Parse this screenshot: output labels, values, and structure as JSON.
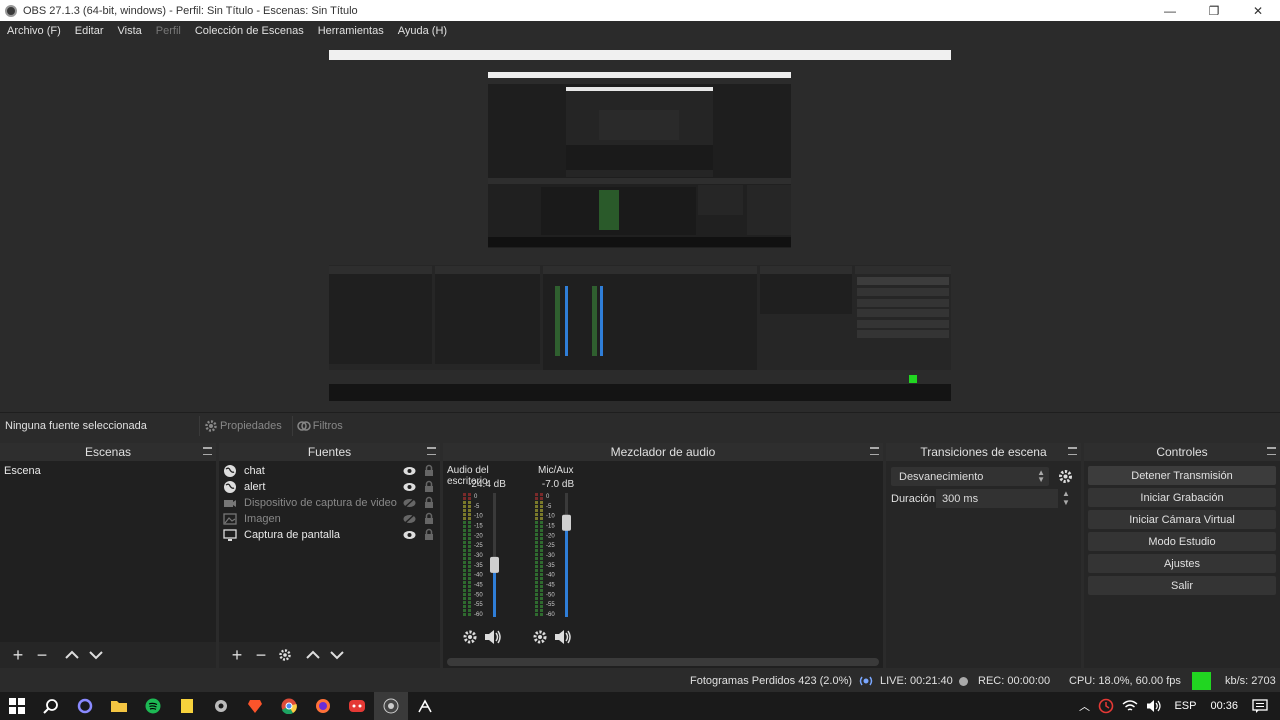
{
  "window": {
    "title": "OBS 27.1.3 (64-bit, windows) - Perfil: Sin Título - Escenas: Sin Título",
    "minimize": "—",
    "restore": "❐",
    "close": "✕"
  },
  "menu": {
    "items": [
      "Archivo (F)",
      "Editar",
      "Vista",
      "Perfil",
      "Colección de Escenas",
      "Herramientas",
      "Ayuda (H)"
    ]
  },
  "context_bar": {
    "no_source": "Ninguna fuente seleccionada",
    "properties": "Propiedades",
    "filters": "Filtros"
  },
  "scenes": {
    "header": "Escenas",
    "items": [
      "Escena"
    ]
  },
  "sources": {
    "header": "Fuentes",
    "items": [
      {
        "name": "chat",
        "icon": "globe-icon",
        "visible": true
      },
      {
        "name": "alert",
        "icon": "globe-icon",
        "visible": true
      },
      {
        "name": "Dispositivo de captura de video",
        "icon": "camera-icon",
        "visible": false
      },
      {
        "name": "Imagen",
        "icon": "image-icon",
        "visible": false
      },
      {
        "name": "Captura de pantalla",
        "icon": "monitor-icon",
        "visible": true
      }
    ]
  },
  "mixer": {
    "header": "Mezclador de audio",
    "channels": [
      {
        "name": "Audio del escritorio",
        "db": "-24.4 dB",
        "level": 0.42
      },
      {
        "name": "Mic/Aux",
        "db": "-7.0 dB",
        "level": 0.76
      }
    ],
    "scale": [
      "0",
      "-5",
      "-10",
      "-15",
      "-20",
      "-25",
      "-30",
      "-35",
      "-40",
      "-45",
      "-50",
      "-55",
      "-60"
    ]
  },
  "transitions": {
    "header": "Transiciones de escena",
    "selected": "Desvanecimiento",
    "duration_label": "Duración",
    "duration_value": "300 ms"
  },
  "controls": {
    "header": "Controles",
    "buttons": [
      "Detener Transmisión",
      "Iniciar Grabación",
      "Iniciar Cámara Virtual",
      "Modo Estudio",
      "Ajustes",
      "Salir"
    ]
  },
  "status": {
    "dropped_frames": "Fotogramas Perdidos 423 (2.0%)",
    "live": "LIVE: 00:21:40",
    "rec": "REC: 00:00:00",
    "cpu": "CPU: 18.0%, 60.00 fps",
    "kbs": "kb/s: 2703",
    "status_color": "#21d621"
  },
  "taskbar": {
    "lang": "ESP",
    "time": "00:36"
  },
  "colors": {
    "accent": "#2f7ed8",
    "bg": "#2b2b2b",
    "panel": "#202020",
    "green_meter": "#3b8f3b"
  }
}
